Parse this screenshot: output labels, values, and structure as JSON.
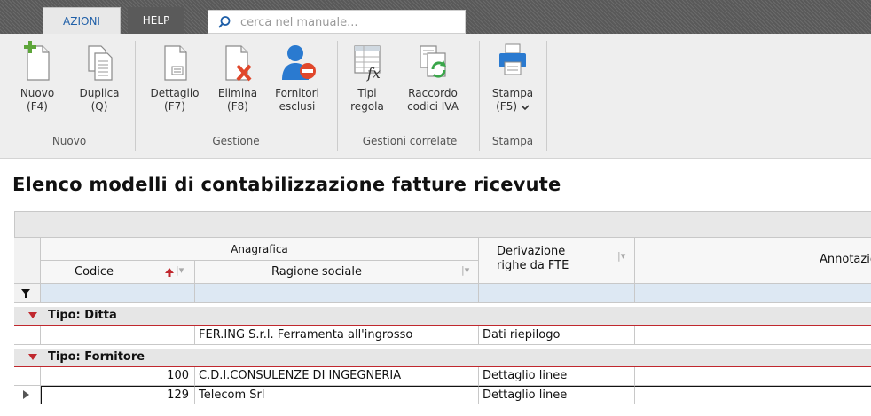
{
  "tabs": {
    "azioni": "AZIONI",
    "help": "HELP"
  },
  "search": {
    "placeholder": "cerca nel manuale..."
  },
  "ribbon": {
    "nuovo": {
      "line1": "Nuovo",
      "line2": "(F4)"
    },
    "duplica": {
      "line1": "Duplica",
      "line2": "(Q)"
    },
    "dettaglio": {
      "line1": "Dettaglio",
      "line2": "(F7)"
    },
    "elimina": {
      "line1": "Elimina",
      "line2": "(F8)"
    },
    "fornitori": {
      "line1": "Fornitori",
      "line2": "esclusi"
    },
    "tipi": {
      "line1": "Tipi",
      "line2": "regola"
    },
    "raccordo": {
      "line1": "Raccordo",
      "line2": "codici IVA"
    },
    "stampa": {
      "line1": "Stampa",
      "line2": "(F5)"
    },
    "groups": {
      "nuovo": "Nuovo",
      "gestione": "Gestione",
      "gestioni_correlate": "Gestioni correlate",
      "stampa": "Stampa"
    }
  },
  "page": {
    "title": "Elenco modelli di contabilizzazione fatture ricevute"
  },
  "grid": {
    "headers": {
      "anagrafica": "Anagrafica",
      "codice": "Codice",
      "ragione_sociale": "Ragione sociale",
      "derivazione_line1": "Derivazione",
      "derivazione_line2": "righe da FTE",
      "annotazioni": "Annotazion"
    },
    "groups": [
      {
        "label": "Tipo:  Ditta",
        "rows": [
          {
            "codice": "",
            "ragione": "FER.ING S.r.l. Ferramenta all'ingrosso",
            "derivazione": "Dati riepilogo"
          }
        ]
      },
      {
        "label": "Tipo:  Fornitore",
        "rows": [
          {
            "codice": "100",
            "ragione": "C.D.I.CONSULENZE DI INGEGNERIA",
            "derivazione": "Dettaglio linee"
          },
          {
            "codice": "129",
            "ragione": "Telecom Srl",
            "derivazione": "Dettaglio linee"
          }
        ]
      }
    ]
  },
  "colors": {
    "accent_red": "#c0282e",
    "tab_blue": "#1f5fa8",
    "filter_blue": "#dde8f3"
  },
  "icons": [
    "search-icon",
    "new-document-icon",
    "duplicate-icon",
    "detail-icon",
    "delete-icon",
    "excluded-suppliers-icon",
    "formula-icon",
    "refresh-doc-icon",
    "printer-icon",
    "filter-icon",
    "sort-asc-icon",
    "row-pointer-icon"
  ]
}
